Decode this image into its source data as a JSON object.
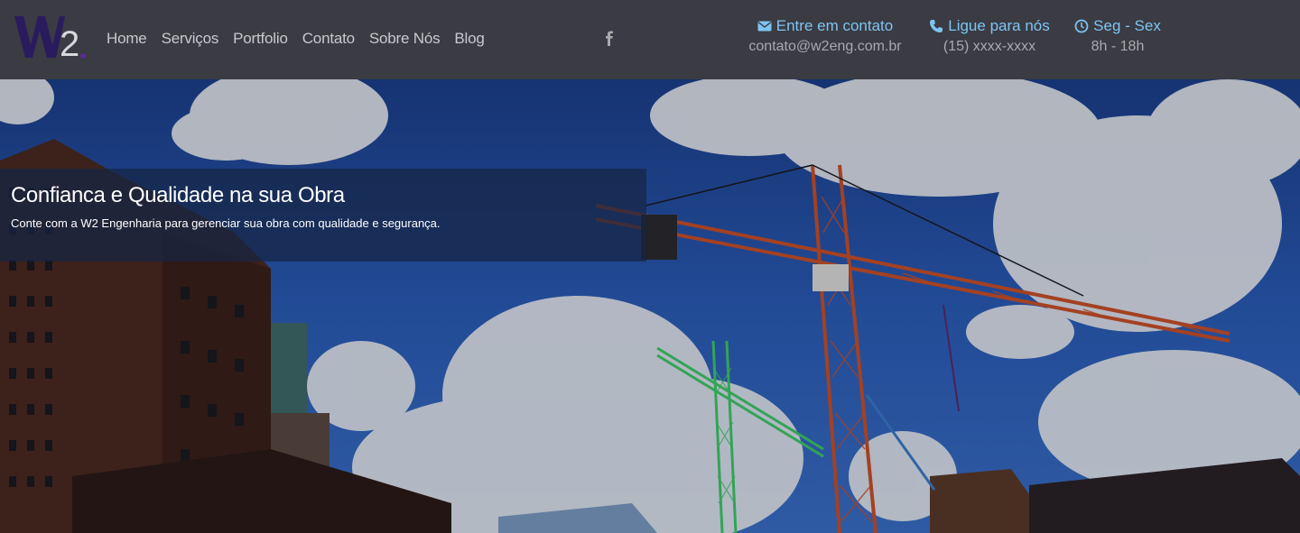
{
  "brand": {
    "logo_text": "W2",
    "logo_color": "#2a1a5e"
  },
  "nav": {
    "items": [
      {
        "label": "Home"
      },
      {
        "label": "Serviços"
      },
      {
        "label": "Portfolio"
      },
      {
        "label": "Contato"
      },
      {
        "label": "Sobre Nós"
      },
      {
        "label": "Blog"
      }
    ]
  },
  "social": {
    "icon": "facebook-icon"
  },
  "contact": {
    "email": {
      "title": "Entre em contato",
      "value": "contato@w2eng.com.br",
      "icon": "envelope-icon"
    },
    "phone": {
      "title": "Ligue para nós",
      "value": "(15) xxxx-xxxx",
      "icon": "phone-icon"
    },
    "hours": {
      "title": "Seg - Sex",
      "value": "8h - 18h",
      "icon": "clock-icon"
    }
  },
  "hero": {
    "title": "Confianca e Qualidade na sua Obra",
    "subtitle": "Conte com a W2 Engenharia para gerenciar sua obra com qualidade e segurança."
  },
  "colors": {
    "navbar_bg": "#3a3b43",
    "accent": "#7ec4f2",
    "nav_text": "#c8c9cc",
    "caption_bg": "#162544"
  }
}
